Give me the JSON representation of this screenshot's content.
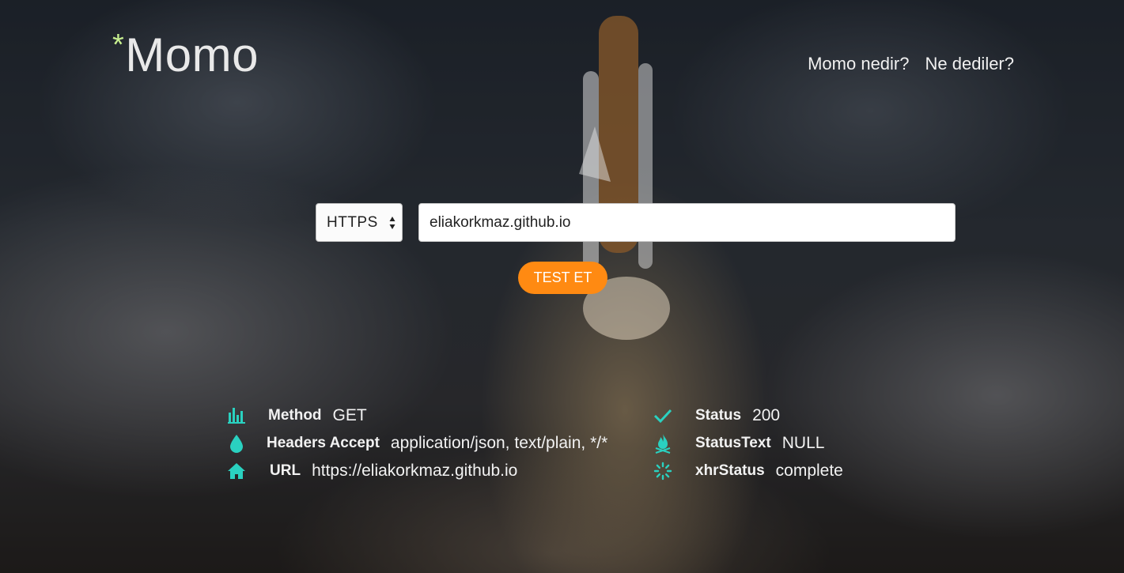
{
  "brand": {
    "star": "*",
    "name": "Momo",
    "star_color": "#c7f08f"
  },
  "nav": {
    "items": [
      {
        "label": "Momo nedir?"
      },
      {
        "label": "Ne dediler?"
      }
    ]
  },
  "form": {
    "protocol_selected": "HTTPS",
    "url_value": "eliakorkmaz.github.io",
    "submit_label": "TEST ET",
    "submit_color": "#ff8a12"
  },
  "results": {
    "accent_color": "#2ad1c0",
    "left": [
      {
        "icon": "bar-chart-icon",
        "label": "Method",
        "value": "GET"
      },
      {
        "icon": "water-drop-icon",
        "label": "Headers Accept",
        "value": "application/json, text/plain, */*"
      },
      {
        "icon": "home-icon",
        "label": "URL",
        "value": "https://eliakorkmaz.github.io"
      }
    ],
    "right": [
      {
        "icon": "checkmark-icon",
        "label": "Status",
        "value": "200"
      },
      {
        "icon": "fire-icon",
        "label": "StatusText",
        "value": "NULL"
      },
      {
        "icon": "spinner-icon",
        "label": "xhrStatus",
        "value": "complete"
      }
    ]
  }
}
